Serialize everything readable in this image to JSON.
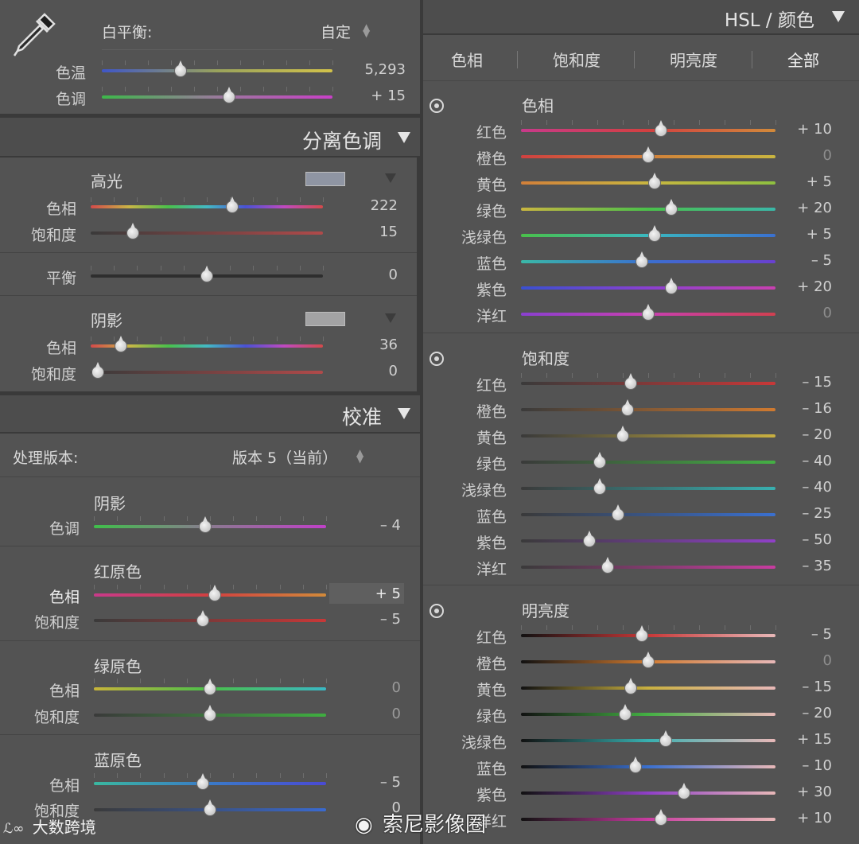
{
  "basic": {
    "white_balance_label": "白平衡:",
    "white_balance_value": "自定",
    "temp": {
      "label": "色温",
      "value": "5,293",
      "pos": 0.34
    },
    "tint": {
      "label": "色调",
      "value": "+ 15",
      "pos": 0.55
    }
  },
  "split_toning": {
    "title": "分离色调",
    "highlights": {
      "title": "高光",
      "swatch_color": "#8f95a3",
      "hue": {
        "label": "色相",
        "value": "222",
        "pos": 0.61
      },
      "sat": {
        "label": "饱和度",
        "value": "15",
        "pos": 0.18
      }
    },
    "balance": {
      "label": "平衡",
      "value": "0",
      "pos": 0.5
    },
    "shadows": {
      "title": "阴影",
      "swatch_color": "#a3a3a4",
      "hue": {
        "label": "色相",
        "value": "36",
        "pos": 0.13
      },
      "sat": {
        "label": "饱和度",
        "value": "0",
        "pos": 0.03
      }
    }
  },
  "calibration": {
    "title": "校准",
    "process_label": "处理版本:",
    "process_value": "版本 5（当前）",
    "shadows": {
      "title": "阴影",
      "tint": {
        "label": "色调",
        "value": "– 4",
        "pos": 0.48
      }
    },
    "red": {
      "title": "红原色",
      "hue": {
        "label": "色相",
        "value": "+ 5",
        "pos": 0.52
      },
      "sat": {
        "label": "饱和度",
        "value": "– 5",
        "pos": 0.47
      }
    },
    "green": {
      "title": "绿原色",
      "hue": {
        "label": "色相",
        "value": "0",
        "pos": 0.5
      },
      "sat": {
        "label": "饱和度",
        "value": "0",
        "pos": 0.5
      }
    },
    "blue": {
      "title": "蓝原色",
      "hue": {
        "label": "色相",
        "value": "– 5",
        "pos": 0.47
      },
      "sat": {
        "label": "饱和度",
        "value": "0",
        "pos": 0.5
      }
    }
  },
  "hsl": {
    "title": "HSL / 颜色",
    "tabs": [
      "色相",
      "饱和度",
      "明亮度",
      "全部"
    ],
    "groups": [
      {
        "title": "色相",
        "rows": [
          {
            "label": "红色",
            "value": "+ 10",
            "pos": 0.55
          },
          {
            "label": "橙色",
            "value": "0",
            "pos": 0.5
          },
          {
            "label": "黄色",
            "value": "+ 5",
            "pos": 0.525
          },
          {
            "label": "绿色",
            "value": "+ 20",
            "pos": 0.59
          },
          {
            "label": "浅绿色",
            "value": "+ 5",
            "pos": 0.525
          },
          {
            "label": "蓝色",
            "value": "– 5",
            "pos": 0.475
          },
          {
            "label": "紫色",
            "value": "+ 20",
            "pos": 0.59
          },
          {
            "label": "洋红",
            "value": "0",
            "pos": 0.5
          }
        ]
      },
      {
        "title": "饱和度",
        "rows": [
          {
            "label": "红色",
            "value": "– 15",
            "pos": 0.43
          },
          {
            "label": "橙色",
            "value": "– 16",
            "pos": 0.42
          },
          {
            "label": "黄色",
            "value": "– 20",
            "pos": 0.4
          },
          {
            "label": "绿色",
            "value": "– 40",
            "pos": 0.31
          },
          {
            "label": "浅绿色",
            "value": "– 40",
            "pos": 0.31
          },
          {
            "label": "蓝色",
            "value": "– 25",
            "pos": 0.38
          },
          {
            "label": "紫色",
            "value": "– 50",
            "pos": 0.27
          },
          {
            "label": "洋红",
            "value": "– 35",
            "pos": 0.34
          }
        ]
      },
      {
        "title": "明亮度",
        "rows": [
          {
            "label": "红色",
            "value": "– 5",
            "pos": 0.475
          },
          {
            "label": "橙色",
            "value": "0",
            "pos": 0.5
          },
          {
            "label": "黄色",
            "value": "– 15",
            "pos": 0.43
          },
          {
            "label": "绿色",
            "value": "– 20",
            "pos": 0.41
          },
          {
            "label": "浅绿色",
            "value": "+ 15",
            "pos": 0.57
          },
          {
            "label": "蓝色",
            "value": "– 10",
            "pos": 0.45
          },
          {
            "label": "紫色",
            "value": "+ 30",
            "pos": 0.64
          },
          {
            "label": "洋红",
            "value": "+ 10",
            "pos": 0.55
          }
        ]
      }
    ]
  },
  "watermarks": {
    "left": "大数跨境",
    "right": "索尼影像圈"
  }
}
